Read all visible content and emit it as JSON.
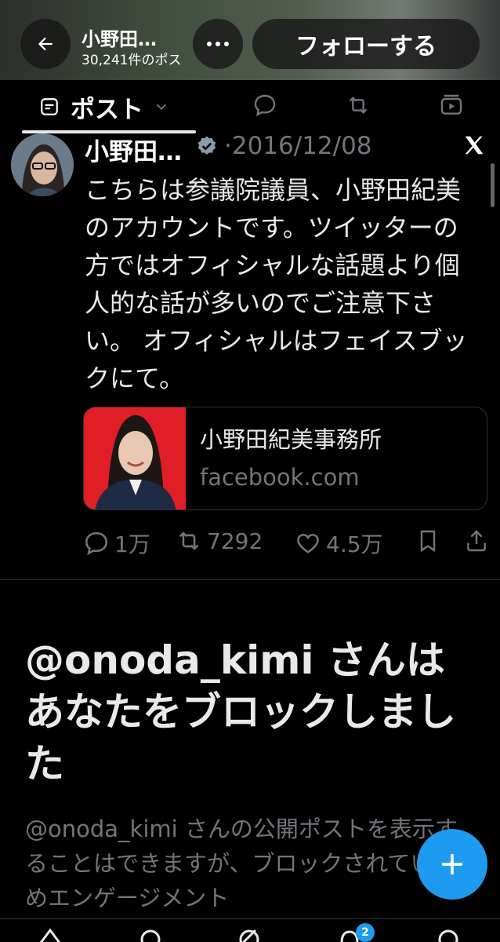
{
  "header": {
    "name": "小野田…",
    "post_count": "30,241件のポス",
    "follow_label": "フォローする"
  },
  "tabs": [
    {
      "label": "ポスト",
      "icon": "posts-icon",
      "active": true
    },
    {
      "label": "",
      "icon": "reply-icon"
    },
    {
      "label": "",
      "icon": "repost-icon"
    },
    {
      "label": "",
      "icon": "media-icon"
    }
  ],
  "tweet": {
    "name": "小野田…",
    "separator": "·",
    "date": "2016/12/08",
    "text": "こちらは参議院議員、小野田紀美のアカウントです。ツイッターの方ではオフィシャルな話題より個人的な話が多いのでご注意下さい。 オフィシャルはフェイスブックにて。",
    "card": {
      "title": "小野田紀美事務所",
      "domain": "facebook.com"
    },
    "actions": {
      "replies": "1万",
      "reposts": "7292",
      "likes": "4.5万"
    }
  },
  "blocked": {
    "title": "@onoda_kimi さんはあなたをブロックしました",
    "description": "@onoda_kimi さんの公開ポストを表示することはできますが、ブロックされているためエンゲージメント"
  },
  "nav": {
    "notification_badge": "2"
  },
  "colors": {
    "accent": "#1d9bf0",
    "muted": "#71767b",
    "card_bg": "#e11d26"
  }
}
